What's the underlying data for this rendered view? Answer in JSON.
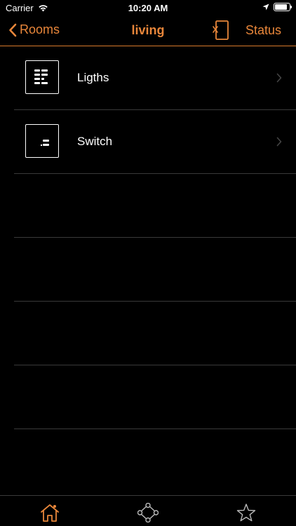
{
  "status_bar": {
    "carrier": "Carrier",
    "time": "10:20 AM",
    "battery_level": 0.95
  },
  "nav": {
    "back_label": "Rooms",
    "title": "living",
    "status_label": "Status"
  },
  "items": [
    {
      "label": "Ligths",
      "icon": "lights-grid-icon"
    },
    {
      "label": "Switch",
      "icon": "switch-icon"
    }
  ],
  "tabs": [
    {
      "name": "home-icon",
      "active": true
    },
    {
      "name": "network-icon",
      "active": false
    },
    {
      "name": "star-icon",
      "active": false
    }
  ],
  "colors": {
    "accent": "#e8863a",
    "background": "#000000",
    "separator": "#3a3a3a",
    "text": "#ffffff"
  }
}
